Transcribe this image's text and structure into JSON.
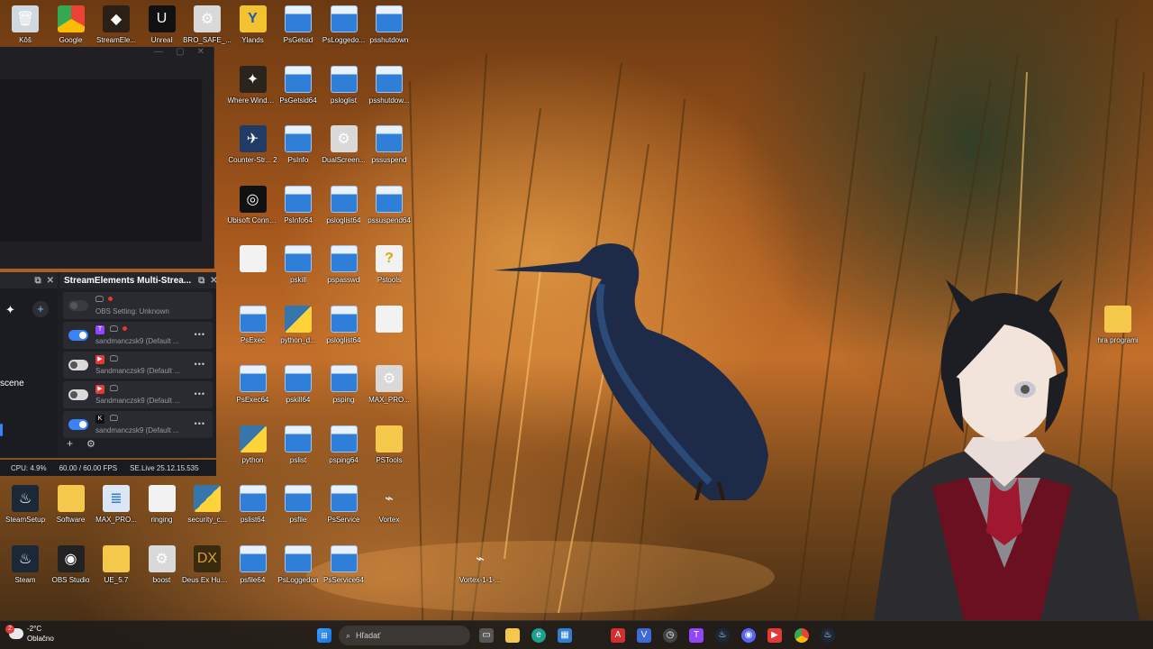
{
  "desktop": {
    "icons": [
      {
        "label": "Kôš",
        "glyph": "bin",
        "col": 0,
        "row": 0
      },
      {
        "label": "Google",
        "glyph": "chrome",
        "col": 1,
        "row": 0
      },
      {
        "label": "StreamEle...",
        "glyph": "se",
        "col": 2,
        "row": 0
      },
      {
        "label": "Unreal",
        "glyph": "unreal",
        "col": 3,
        "row": 0
      },
      {
        "label": "BRO_SAFE_...",
        "glyph": "gear",
        "col": 4,
        "row": 0
      },
      {
        "label": "Ylands",
        "glyph": "ylands",
        "col": 5,
        "row": 0
      },
      {
        "label": "PsGetsid",
        "glyph": "app",
        "col": 6,
        "row": 0
      },
      {
        "label": "PsLoggedo...",
        "glyph": "app",
        "col": 7,
        "row": 0
      },
      {
        "label": "psshutdown",
        "glyph": "app",
        "col": 8,
        "row": 0
      },
      {
        "label": "Where Winds Meet",
        "glyph": "wwm",
        "col": 5,
        "row": 1
      },
      {
        "label": "PsGetsid64",
        "glyph": "app",
        "col": 6,
        "row": 1
      },
      {
        "label": "psloglist",
        "glyph": "app",
        "col": 7,
        "row": 1
      },
      {
        "label": "psshutdow...",
        "glyph": "app",
        "col": 8,
        "row": 1
      },
      {
        "label": "Counter-Str... 2",
        "glyph": "cs",
        "col": 5,
        "row": 2
      },
      {
        "label": "PsInfo",
        "glyph": "app",
        "col": 6,
        "row": 2
      },
      {
        "label": "DualScreen...",
        "glyph": "gear",
        "col": 7,
        "row": 2
      },
      {
        "label": "pssuspend",
        "glyph": "app",
        "col": 8,
        "row": 2
      },
      {
        "label": "Ubisoft Connect",
        "glyph": "ubi",
        "col": 5,
        "row": 3
      },
      {
        "label": "PsInfo64",
        "glyph": "app",
        "col": 6,
        "row": 3
      },
      {
        "label": "psloglist64",
        "glyph": "app",
        "col": 7,
        "row": 3
      },
      {
        "label": "pssuspend64",
        "glyph": "app",
        "col": 8,
        "row": 3
      },
      {
        "label": "",
        "glyph": "file",
        "col": 5,
        "row": 4
      },
      {
        "label": "pskill",
        "glyph": "app",
        "col": 6,
        "row": 4
      },
      {
        "label": "pspasswd",
        "glyph": "app",
        "col": 7,
        "row": 4
      },
      {
        "label": "Pstools",
        "glyph": "help",
        "col": 8,
        "row": 4
      },
      {
        "label": "PsExec",
        "glyph": "app",
        "col": 5,
        "row": 5
      },
      {
        "label": "python_d...",
        "glyph": "py",
        "col": 6,
        "row": 5
      },
      {
        "label": "psloglist64",
        "glyph": "app",
        "col": 7,
        "row": 5
      },
      {
        "label": "",
        "glyph": "file",
        "col": 8,
        "row": 5
      },
      {
        "label": "PsExec64",
        "glyph": "app",
        "col": 5,
        "row": 6
      },
      {
        "label": "pskill64",
        "glyph": "app",
        "col": 6,
        "row": 6
      },
      {
        "label": "psping",
        "glyph": "app",
        "col": 7,
        "row": 6
      },
      {
        "label": "MAX_PRO...",
        "glyph": "gear",
        "col": 8,
        "row": 6
      },
      {
        "label": "python",
        "glyph": "py",
        "col": 5,
        "row": 7
      },
      {
        "label": "pslist",
        "glyph": "app",
        "col": 6,
        "row": 7
      },
      {
        "label": "psping64",
        "glyph": "app",
        "col": 7,
        "row": 7
      },
      {
        "label": "PSTools",
        "glyph": "folder",
        "col": 8,
        "row": 7
      },
      {
        "label": "SteamSetup",
        "glyph": "steam",
        "col": 0,
        "row": 8
      },
      {
        "label": "Software",
        "glyph": "folder",
        "col": 1,
        "row": 8
      },
      {
        "label": "MAX_PRO...",
        "glyph": "doc",
        "col": 2,
        "row": 8
      },
      {
        "label": "ringing",
        "glyph": "file",
        "col": 3,
        "row": 8
      },
      {
        "label": "security_c...",
        "glyph": "py",
        "col": 4,
        "row": 8
      },
      {
        "label": "pslist64",
        "glyph": "app",
        "col": 5,
        "row": 8
      },
      {
        "label": "psfile",
        "glyph": "app",
        "col": 6,
        "row": 8
      },
      {
        "label": "PsService",
        "glyph": "app",
        "col": 7,
        "row": 8
      },
      {
        "label": "Vortex",
        "glyph": "vortex",
        "col": 8,
        "row": 8
      },
      {
        "label": "Steam",
        "glyph": "steam",
        "col": 0,
        "row": 9
      },
      {
        "label": "OBS Studio",
        "glyph": "obs",
        "col": 1,
        "row": 9
      },
      {
        "label": "UE_5.7",
        "glyph": "folder",
        "col": 2,
        "row": 9
      },
      {
        "label": "boost",
        "glyph": "gear",
        "col": 3,
        "row": 9
      },
      {
        "label": "Deus Ex Human Rev...",
        "glyph": "deus",
        "col": 4,
        "row": 9
      },
      {
        "label": "psfile64",
        "glyph": "app",
        "col": 5,
        "row": 9
      },
      {
        "label": "PsLoggedon",
        "glyph": "app",
        "col": 6,
        "row": 9
      },
      {
        "label": "PsService64",
        "glyph": "app",
        "col": 7,
        "row": 9
      },
      {
        "label": "Vortex-1-1-...",
        "glyph": "vortex",
        "col": 10,
        "row": 9
      },
      {
        "label": "hra programi",
        "glyph": "folder",
        "col": 24,
        "row": 5
      }
    ]
  },
  "obs": {
    "dock_title": "StreamElements Multi-Strea...",
    "scenes_label": "scene",
    "rows": [
      {
        "enabled": "dis",
        "service": "",
        "service_color": "",
        "live": true,
        "text": "OBS Setting: Unknown",
        "show_dots": false
      },
      {
        "enabled": "on",
        "service": "T",
        "service_color": "#9146ff",
        "live": true,
        "text": "sandmanczsk9 (Default ...",
        "show_dots": true
      },
      {
        "enabled": "off",
        "service": "▶",
        "service_color": "#e53935",
        "live": false,
        "text": "Sandmanczsk9 (Default ...",
        "show_dots": true
      },
      {
        "enabled": "off",
        "service": "▶",
        "service_color": "#e53935",
        "live": false,
        "text": "Sandmanczsk9 (Default ...",
        "show_dots": true
      },
      {
        "enabled": "on",
        "service": "K",
        "service_color": "#111111",
        "live": false,
        "text": "sandmanczsk9 (Default ...",
        "show_dots": true
      }
    ],
    "status": {
      "cpu": "CPU: 4.9%",
      "fps": "60.00 / 60.00 FPS",
      "version": "SE.Live 25.12.15.535"
    }
  },
  "taskbar": {
    "weather_temp": "-2°C",
    "weather_desc": "Oblačno",
    "weather_badge": "2",
    "search_placeholder": "Hľadať",
    "apps": [
      "widgets",
      "windows",
      "search",
      "task-view",
      "explorer",
      "edge",
      "store",
      "acrobat",
      "vortex",
      "clock",
      "twitch",
      "steam",
      "discord",
      "youtube",
      "chrome",
      "steam2"
    ]
  },
  "colors": {
    "accent": "#3b82f6",
    "win_blue": "#2f7fd8",
    "folder": "#f4c84a"
  }
}
